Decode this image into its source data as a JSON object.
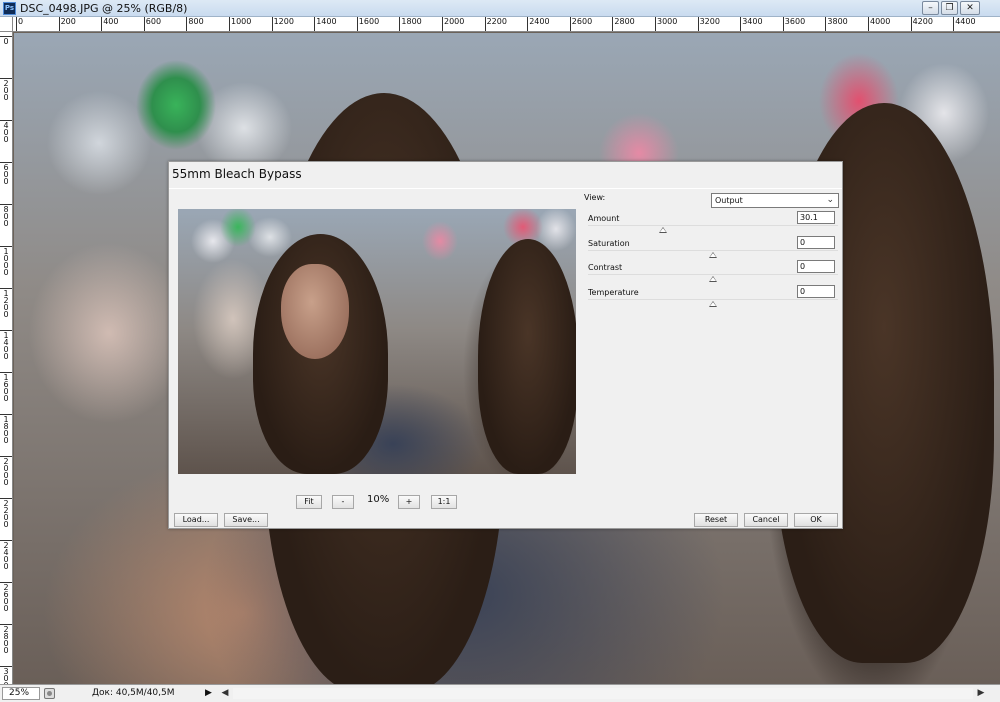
{
  "window": {
    "app_icon": "Ps",
    "title": "DSC_0498.JPG @ 25% (RGB/8)",
    "minimize": "–",
    "restore": "❐",
    "close": "✕"
  },
  "rulers": {
    "horizontal": [
      "0",
      "200",
      "400",
      "600",
      "800",
      "1000",
      "1200",
      "1400",
      "1600",
      "1800",
      "2000",
      "2200",
      "2400",
      "2600",
      "2800",
      "3000",
      "3200",
      "3400",
      "3600",
      "3800",
      "4000",
      "4200",
      "4400"
    ],
    "vertical": [
      "0",
      "200",
      "400",
      "600",
      "800",
      "1000",
      "1200",
      "1400",
      "1600",
      "1800",
      "2000",
      "2200",
      "2400",
      "2600",
      "2800",
      "3000"
    ]
  },
  "dialog": {
    "title": "55mm Bleach Bypass",
    "view_label": "View:",
    "view_value": "Output",
    "params": [
      {
        "label": "Amount",
        "value": "30.1",
        "level": 0.3
      },
      {
        "label": "Saturation",
        "value": "0",
        "level": 0.5
      },
      {
        "label": "Contrast",
        "value": "0",
        "level": 0.5
      },
      {
        "label": "Temperature",
        "value": "0",
        "level": 0.5
      }
    ],
    "zoom": {
      "fit": "Fit",
      "minus": "-",
      "value": "10%",
      "plus": "+",
      "one_to_one": "1:1"
    },
    "buttons": {
      "load": "Load...",
      "save": "Save...",
      "reset": "Reset",
      "cancel": "Cancel",
      "ok": "OK"
    }
  },
  "status": {
    "zoom": "25%",
    "doc_info": "Док: 40,5M/40,5M",
    "arrow": "▶",
    "scroll_left": "◀",
    "scroll_right": "▶"
  }
}
